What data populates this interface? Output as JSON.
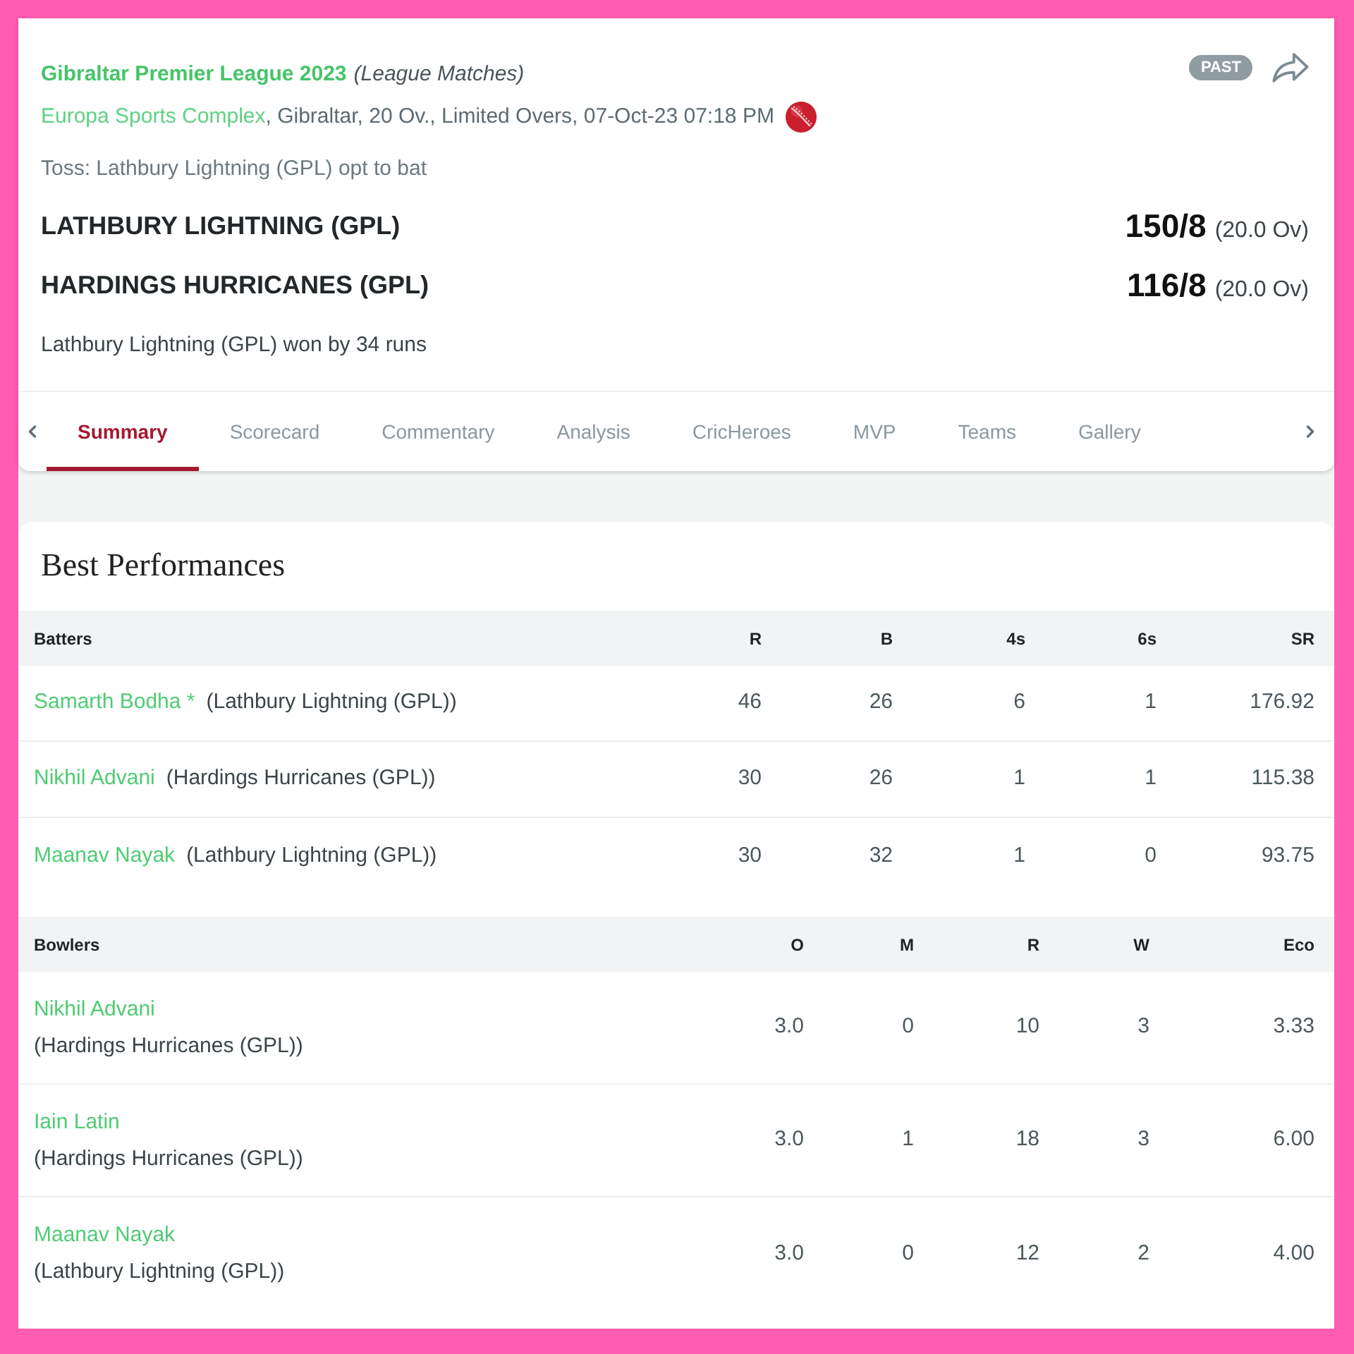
{
  "match": {
    "tournament": "Gibraltar Premier League 2023",
    "round": "(League Matches)",
    "status": "PAST",
    "venue": "Europa Sports Complex",
    "details": ", Gibraltar, 20 Ov., Limited Overs, 07-Oct-23 07:18 PM",
    "toss": "Toss: Lathbury Lightning (GPL) opt to bat",
    "teams": [
      {
        "name": "LATHBURY LIGHTNING (GPL)",
        "score": "150/8",
        "overs": "(20.0 Ov)"
      },
      {
        "name": "HARDINGS HURRICANES (GPL)",
        "score": "116/8",
        "overs": "(20.0 Ov)"
      }
    ],
    "result": "Lathbury Lightning (GPL) won by 34 runs"
  },
  "tabs": [
    {
      "label": "Summary",
      "selected": true
    },
    {
      "label": "Scorecard",
      "selected": false
    },
    {
      "label": "Commentary",
      "selected": false
    },
    {
      "label": "Analysis",
      "selected": false
    },
    {
      "label": "CricHeroes",
      "selected": false
    },
    {
      "label": "MVP",
      "selected": false
    },
    {
      "label": "Teams",
      "selected": false
    },
    {
      "label": "Gallery",
      "selected": false
    }
  ],
  "best_performances": {
    "title": "Best Performances",
    "tables": [
      {
        "kind": "batting",
        "columns": [
          "Batters",
          "R",
          "B",
          "4s",
          "6s",
          "SR"
        ],
        "rows": [
          {
            "player": "Samarth Bodha *",
            "team": "(Lathbury Lightning (GPL))",
            "values": [
              "46",
              "26",
              "6",
              "1",
              "176.92"
            ]
          },
          {
            "player": "Nikhil Advani",
            "team": "(Hardings Hurricanes (GPL))",
            "values": [
              "30",
              "26",
              "1",
              "1",
              "115.38"
            ]
          },
          {
            "player": "Maanav Nayak",
            "team": "(Lathbury Lightning (GPL))",
            "values": [
              "30",
              "32",
              "1",
              "0",
              "93.75"
            ]
          }
        ]
      },
      {
        "kind": "bowling",
        "columns": [
          "Bowlers",
          "O",
          "M",
          "R",
          "W",
          "Eco"
        ],
        "rows": [
          {
            "player": "Nikhil Advani",
            "team": "(Hardings Hurricanes (GPL))",
            "values": [
              "3.0",
              "0",
              "10",
              "3",
              "3.33"
            ]
          },
          {
            "player": "Iain Latin",
            "team": "(Hardings Hurricanes (GPL))",
            "values": [
              "3.0",
              "1",
              "18",
              "3",
              "6.00"
            ]
          },
          {
            "player": "Maanav Nayak",
            "team": "(Lathbury Lightning (GPL))",
            "values": [
              "3.0",
              "0",
              "12",
              "2",
              "4.00"
            ]
          }
        ]
      }
    ]
  }
}
